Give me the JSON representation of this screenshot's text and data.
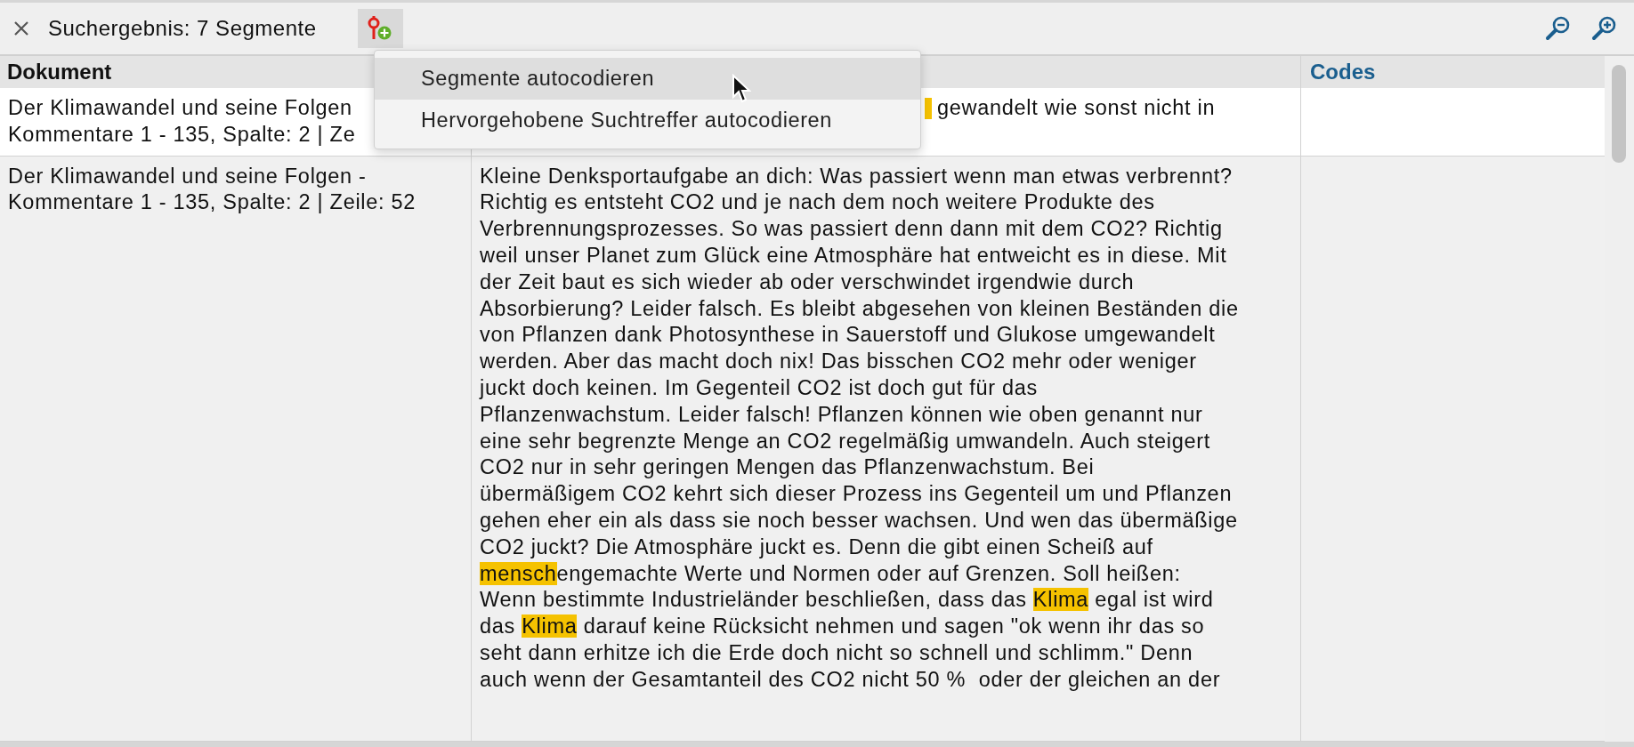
{
  "toolbar": {
    "title": "Suchergebnis: 7 Segmente",
    "autocode_pressed": true
  },
  "menu": {
    "items": [
      {
        "label": "Segmente autocodieren",
        "selected": true
      },
      {
        "label": "Hervorgehobene Suchtreffer autocodieren",
        "selected": false
      }
    ]
  },
  "table": {
    "header": {
      "document": "Dokument",
      "codes": "Codes"
    },
    "rows": [
      {
        "selected": false,
        "cut_highlight": true,
        "document": [
          "Der Klimawandel und seine Folgen",
          "Kommentare 1 - 135, Spalte: 2 | Ze"
        ],
        "segment_lines": [
          [
            {
              "text": "gewandelt wie sonst nicht in",
              "highlight": false
            }
          ]
        ]
      },
      {
        "selected": true,
        "document": [
          "Der Klimawandel und seine Folgen -",
          "Kommentare 1 - 135, Spalte: 2 | Zeile: 52"
        ],
        "segment_lines": [
          [
            {
              "text": "Kleine Denksportaufgabe an dich: Was passiert wenn man etwas verbrennt?",
              "highlight": false
            }
          ],
          [
            {
              "text": "Richtig es entsteht CO2 und je nach dem noch weitere Produkte des",
              "highlight": false
            }
          ],
          [
            {
              "text": "Verbrennungsprozesses. So was passiert denn dann mit dem CO2? Richtig",
              "highlight": false
            }
          ],
          [
            {
              "text": "weil unser Planet zum Glück eine Atmosphäre hat entweicht es in diese. Mit",
              "highlight": false
            }
          ],
          [
            {
              "text": "der Zeit baut es sich wieder ab oder verschwindet irgendwie durch",
              "highlight": false
            }
          ],
          [
            {
              "text": "Absorbierung? Leider falsch. Es bleibt abgesehen von kleinen Beständen die",
              "highlight": false
            }
          ],
          [
            {
              "text": "von Pflanzen dank Photosynthese in Sauerstoff und Glukose umgewandelt",
              "highlight": false
            }
          ],
          [
            {
              "text": "werden. Aber das macht doch nix! Das bisschen CO2 mehr oder weniger",
              "highlight": false
            }
          ],
          [
            {
              "text": "juckt doch keinen. Im Gegenteil CO2 ist doch gut für das",
              "highlight": false
            }
          ],
          [
            {
              "text": "Pflanzenwachstum. Leider falsch! Pflanzen können wie oben genannt nur",
              "highlight": false
            }
          ],
          [
            {
              "text": "eine sehr begrenzte Menge an CO2 regelmäßig umwandeln. Auch steigert",
              "highlight": false
            }
          ],
          [
            {
              "text": "CO2 nur in sehr geringen Mengen das Pflanzenwachstum. Bei",
              "highlight": false
            }
          ],
          [
            {
              "text": "übermäßigem CO2 kehrt sich dieser Prozess ins Gegenteil um und Pflanzen",
              "highlight": false
            }
          ],
          [
            {
              "text": "gehen eher ein als dass sie noch besser wachsen. Und wen das übermäßige",
              "highlight": false
            }
          ],
          [
            {
              "text": "CO2 juckt? Die Atmosphäre juckt es. Denn die gibt einen Scheiß auf",
              "highlight": false
            }
          ],
          [
            {
              "text": "mensch",
              "highlight": true
            },
            {
              "text": "engemachte Werte und Normen oder auf Grenzen. Soll heißen:",
              "highlight": false
            }
          ],
          [
            {
              "text": "Wenn bestimmte Industrieländer beschließen, dass das ",
              "highlight": false
            },
            {
              "text": "Klima",
              "highlight": true
            },
            {
              "text": " egal ist wird",
              "highlight": false
            }
          ],
          [
            {
              "text": "das ",
              "highlight": false
            },
            {
              "text": "Klima",
              "highlight": true
            },
            {
              "text": " darauf keine Rücksicht nehmen und sagen \"ok wenn ihr das so",
              "highlight": false
            }
          ],
          [
            {
              "text": "seht dann erhitze ich die Erde doch nicht so schnell und schlimm.\" Denn",
              "highlight": false
            }
          ],
          [
            {
              "text": "auch wenn der Gesamtanteil des CO2 nicht 50 %  oder der gleichen an der",
              "highlight": false
            }
          ]
        ]
      }
    ]
  }
}
